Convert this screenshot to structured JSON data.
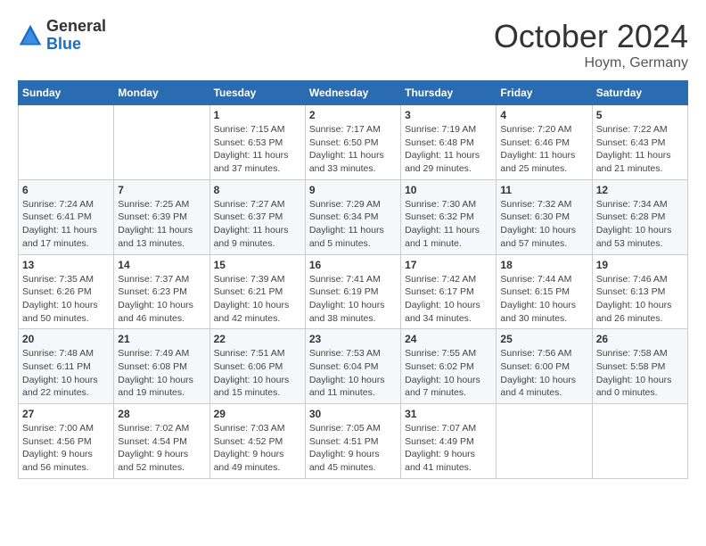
{
  "header": {
    "logo_general": "General",
    "logo_blue": "Blue",
    "month_title": "October 2024",
    "location": "Hoym, Germany"
  },
  "weekdays": [
    "Sunday",
    "Monday",
    "Tuesday",
    "Wednesday",
    "Thursday",
    "Friday",
    "Saturday"
  ],
  "weeks": [
    [
      {
        "day": "",
        "info": ""
      },
      {
        "day": "",
        "info": ""
      },
      {
        "day": "1",
        "info": "Sunrise: 7:15 AM\nSunset: 6:53 PM\nDaylight: 11 hours and 37 minutes."
      },
      {
        "day": "2",
        "info": "Sunrise: 7:17 AM\nSunset: 6:50 PM\nDaylight: 11 hours and 33 minutes."
      },
      {
        "day": "3",
        "info": "Sunrise: 7:19 AM\nSunset: 6:48 PM\nDaylight: 11 hours and 29 minutes."
      },
      {
        "day": "4",
        "info": "Sunrise: 7:20 AM\nSunset: 6:46 PM\nDaylight: 11 hours and 25 minutes."
      },
      {
        "day": "5",
        "info": "Sunrise: 7:22 AM\nSunset: 6:43 PM\nDaylight: 11 hours and 21 minutes."
      }
    ],
    [
      {
        "day": "6",
        "info": "Sunrise: 7:24 AM\nSunset: 6:41 PM\nDaylight: 11 hours and 17 minutes."
      },
      {
        "day": "7",
        "info": "Sunrise: 7:25 AM\nSunset: 6:39 PM\nDaylight: 11 hours and 13 minutes."
      },
      {
        "day": "8",
        "info": "Sunrise: 7:27 AM\nSunset: 6:37 PM\nDaylight: 11 hours and 9 minutes."
      },
      {
        "day": "9",
        "info": "Sunrise: 7:29 AM\nSunset: 6:34 PM\nDaylight: 11 hours and 5 minutes."
      },
      {
        "day": "10",
        "info": "Sunrise: 7:30 AM\nSunset: 6:32 PM\nDaylight: 11 hours and 1 minute."
      },
      {
        "day": "11",
        "info": "Sunrise: 7:32 AM\nSunset: 6:30 PM\nDaylight: 10 hours and 57 minutes."
      },
      {
        "day": "12",
        "info": "Sunrise: 7:34 AM\nSunset: 6:28 PM\nDaylight: 10 hours and 53 minutes."
      }
    ],
    [
      {
        "day": "13",
        "info": "Sunrise: 7:35 AM\nSunset: 6:26 PM\nDaylight: 10 hours and 50 minutes."
      },
      {
        "day": "14",
        "info": "Sunrise: 7:37 AM\nSunset: 6:23 PM\nDaylight: 10 hours and 46 minutes."
      },
      {
        "day": "15",
        "info": "Sunrise: 7:39 AM\nSunset: 6:21 PM\nDaylight: 10 hours and 42 minutes."
      },
      {
        "day": "16",
        "info": "Sunrise: 7:41 AM\nSunset: 6:19 PM\nDaylight: 10 hours and 38 minutes."
      },
      {
        "day": "17",
        "info": "Sunrise: 7:42 AM\nSunset: 6:17 PM\nDaylight: 10 hours and 34 minutes."
      },
      {
        "day": "18",
        "info": "Sunrise: 7:44 AM\nSunset: 6:15 PM\nDaylight: 10 hours and 30 minutes."
      },
      {
        "day": "19",
        "info": "Sunrise: 7:46 AM\nSunset: 6:13 PM\nDaylight: 10 hours and 26 minutes."
      }
    ],
    [
      {
        "day": "20",
        "info": "Sunrise: 7:48 AM\nSunset: 6:11 PM\nDaylight: 10 hours and 22 minutes."
      },
      {
        "day": "21",
        "info": "Sunrise: 7:49 AM\nSunset: 6:08 PM\nDaylight: 10 hours and 19 minutes."
      },
      {
        "day": "22",
        "info": "Sunrise: 7:51 AM\nSunset: 6:06 PM\nDaylight: 10 hours and 15 minutes."
      },
      {
        "day": "23",
        "info": "Sunrise: 7:53 AM\nSunset: 6:04 PM\nDaylight: 10 hours and 11 minutes."
      },
      {
        "day": "24",
        "info": "Sunrise: 7:55 AM\nSunset: 6:02 PM\nDaylight: 10 hours and 7 minutes."
      },
      {
        "day": "25",
        "info": "Sunrise: 7:56 AM\nSunset: 6:00 PM\nDaylight: 10 hours and 4 minutes."
      },
      {
        "day": "26",
        "info": "Sunrise: 7:58 AM\nSunset: 5:58 PM\nDaylight: 10 hours and 0 minutes."
      }
    ],
    [
      {
        "day": "27",
        "info": "Sunrise: 7:00 AM\nSunset: 4:56 PM\nDaylight: 9 hours and 56 minutes."
      },
      {
        "day": "28",
        "info": "Sunrise: 7:02 AM\nSunset: 4:54 PM\nDaylight: 9 hours and 52 minutes."
      },
      {
        "day": "29",
        "info": "Sunrise: 7:03 AM\nSunset: 4:52 PM\nDaylight: 9 hours and 49 minutes."
      },
      {
        "day": "30",
        "info": "Sunrise: 7:05 AM\nSunset: 4:51 PM\nDaylight: 9 hours and 45 minutes."
      },
      {
        "day": "31",
        "info": "Sunrise: 7:07 AM\nSunset: 4:49 PM\nDaylight: 9 hours and 41 minutes."
      },
      {
        "day": "",
        "info": ""
      },
      {
        "day": "",
        "info": ""
      }
    ]
  ]
}
